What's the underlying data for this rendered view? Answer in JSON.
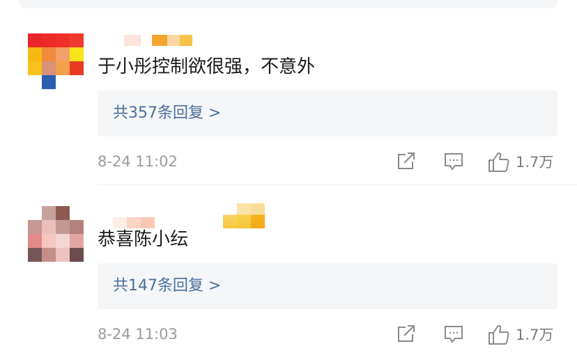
{
  "comments": [
    {
      "text": "于小彤控制欲很强，不意外",
      "replies_label": "共357条回复 >",
      "timestamp": "8-24 11:02",
      "like_count": "1.7万"
    },
    {
      "text": "恭喜陈小纭",
      "replies_label": "共147条回复 >",
      "timestamp": "8-24 11:03",
      "like_count": "1.7万"
    }
  ],
  "icons": {
    "share": "share-external-icon",
    "comment": "comment-bubble-icon",
    "like": "thumbs-up-icon"
  },
  "colors": {
    "link": "#4a6f9c",
    "meta": "#9a9a9a",
    "reply_box_bg": "#f5f6f8"
  }
}
